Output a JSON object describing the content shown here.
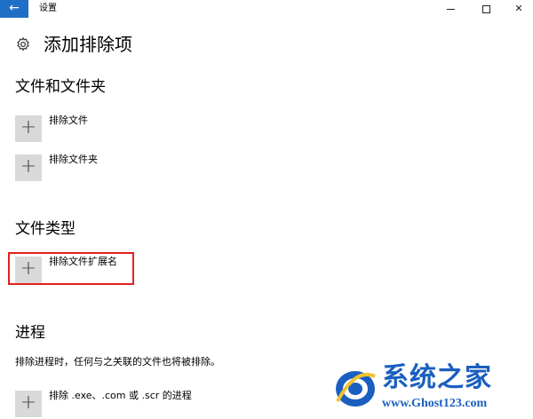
{
  "window": {
    "back_icon": "back-arrow-icon",
    "title": "设置",
    "controls": [
      "minimize-icon",
      "maximize-icon",
      "close-icon"
    ]
  },
  "page": {
    "icon": "gear-icon",
    "title": "添加排除项"
  },
  "sections": {
    "files": {
      "title": "文件和文件夹",
      "buttons": [
        {
          "icon": "plus-icon",
          "label": "排除文件"
        },
        {
          "icon": "plus-icon",
          "label": "排除文件夹"
        }
      ]
    },
    "types": {
      "title": "文件类型",
      "buttons": [
        {
          "icon": "plus-icon",
          "label": "排除文件扩展名",
          "highlighted": true
        }
      ]
    },
    "processes": {
      "title": "进程",
      "description": "排除进程时，任何与之关联的文件也将被排除。",
      "buttons": [
        {
          "icon": "plus-icon",
          "label": "排除 .exe、.com 或 .scr 的进程"
        }
      ]
    }
  },
  "watermark": {
    "name": "系统之家",
    "url": "www.Ghost123.com"
  },
  "colors": {
    "accent": "#1e6fc5",
    "button_bg": "#d9d9d9",
    "highlight_border": "#e02020",
    "watermark": "#1a5fbf"
  }
}
